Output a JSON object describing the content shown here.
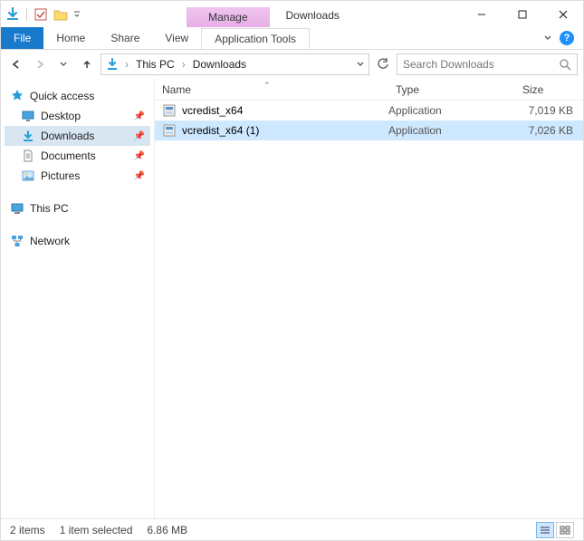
{
  "titlebar": {
    "context_tab": "Manage",
    "window_title": "Downloads"
  },
  "ribbon": {
    "file": "File",
    "tabs": [
      "Home",
      "Share",
      "View"
    ],
    "context_tool": "Application Tools"
  },
  "nav": {
    "breadcrumb": [
      "This PC",
      "Downloads"
    ]
  },
  "search": {
    "placeholder": "Search Downloads"
  },
  "sidebar": {
    "quick_access": "Quick access",
    "items": [
      {
        "label": "Desktop"
      },
      {
        "label": "Downloads"
      },
      {
        "label": "Documents"
      },
      {
        "label": "Pictures"
      }
    ],
    "this_pc": "This PC",
    "network": "Network"
  },
  "columns": {
    "name": "Name",
    "type": "Type",
    "size": "Size"
  },
  "files": [
    {
      "name": "vcredist_x64",
      "type": "Application",
      "size": "7,019 KB"
    },
    {
      "name": "vcredist_x64 (1)",
      "type": "Application",
      "size": "7,026 KB"
    }
  ],
  "status": {
    "count": "2 items",
    "selected": "1 item selected",
    "size": "6.86 MB"
  }
}
